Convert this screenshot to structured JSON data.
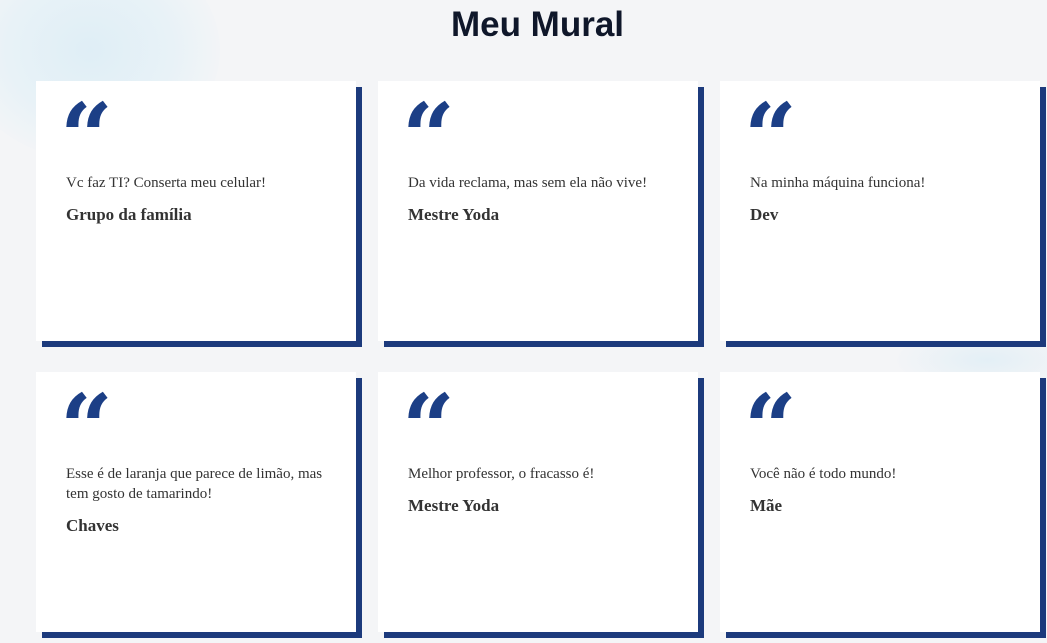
{
  "page": {
    "title": "Meu Mural"
  },
  "icons": {
    "quote": "open-quote-icon",
    "quote_glyph": "“"
  },
  "colors": {
    "accent": "#1c3a7c",
    "quote": "#1c3f86",
    "title": "#0f172a",
    "text": "#333333"
  },
  "cards": [
    {
      "quote": "Vc faz TI? Conserta meu celular!",
      "author": "Grupo da família"
    },
    {
      "quote": "Da vida reclama, mas sem ela não vive!",
      "author": "Mestre Yoda"
    },
    {
      "quote": "Na minha máquina funciona!",
      "author": "Dev"
    },
    {
      "quote": "Esse é de laranja que parece de limão, mas tem gosto de tamarindo!",
      "author": "Chaves"
    },
    {
      "quote": "Melhor professor, o fracasso é!",
      "author": "Mestre Yoda"
    },
    {
      "quote": "Você não é todo mundo!",
      "author": "Mãe"
    }
  ]
}
